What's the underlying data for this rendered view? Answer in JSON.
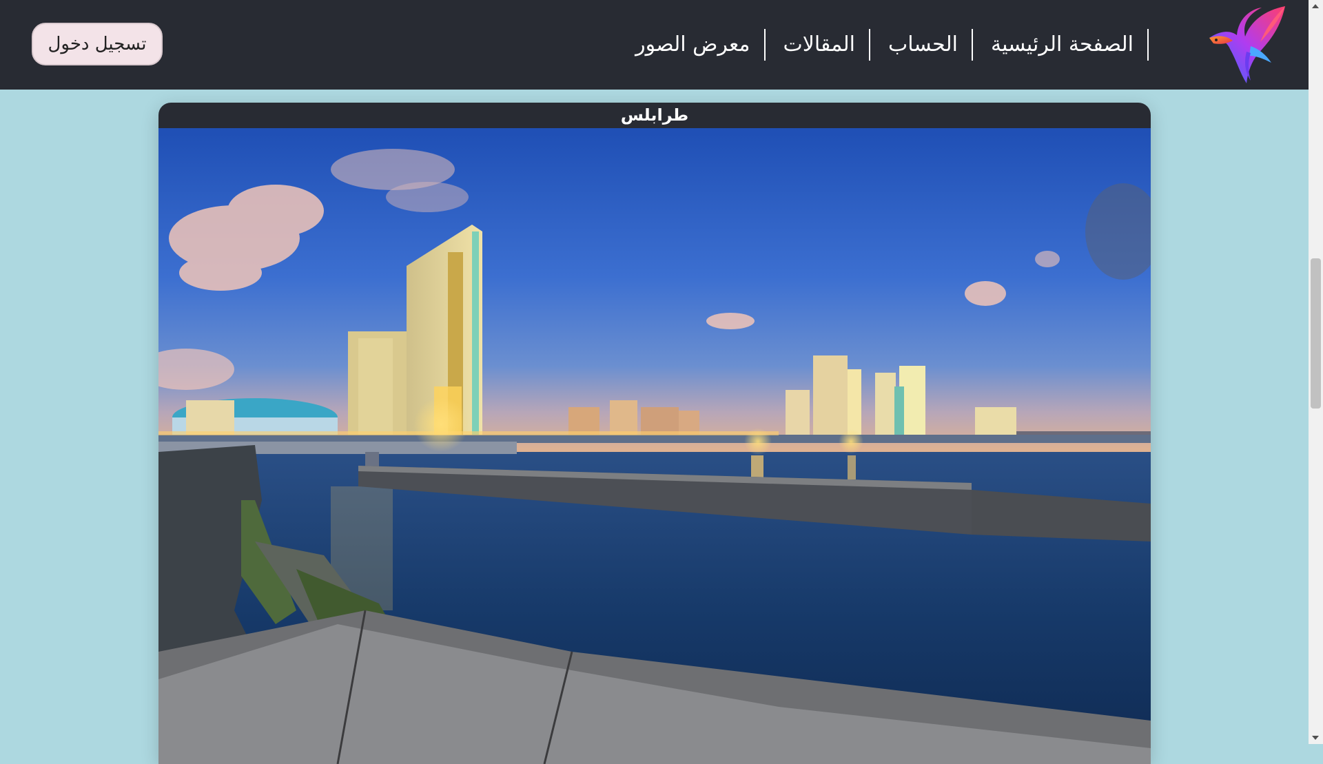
{
  "header": {
    "logo_icon": "phoenix-bird-logo",
    "nav_items": [
      {
        "label": "الصفحة الرئيسية"
      },
      {
        "label": "الحساب"
      },
      {
        "label": "المقالات"
      },
      {
        "label": "معرض الصور"
      }
    ],
    "login_label": "تسجيل دخول"
  },
  "gallery": {
    "card_title": "طرابلس",
    "photo": "night-skyline-waterfront-photo"
  },
  "colors": {
    "header_bg": "#282b33",
    "page_bg": "#add8e0",
    "login_bg": "#f3e3e8"
  }
}
